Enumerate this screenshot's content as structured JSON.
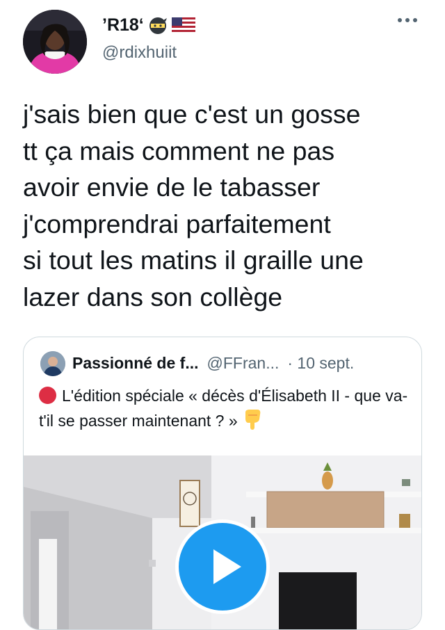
{
  "author": {
    "display_name": "’R18‘",
    "handle": "@rdixhuiit",
    "avatar_icon": "user-avatar",
    "badges": [
      "ninja-emoji-icon",
      "us-flag-icon"
    ]
  },
  "more_icon": "more-horizontal-icon",
  "tweet": {
    "text": "j'sais bien que c'est un gosse\ntt ça mais comment ne pas\navoir envie de le tabasser\nj'comprendrai parfaitement\nsi tout les matins il graille une\nlazer dans son collège"
  },
  "quote": {
    "display_name": "Passionné de f...",
    "handle": "@FFran...",
    "date": "· 10 sept.",
    "text": "L'édition spéciale « décès d'Élisabeth II - que va-t'il se passer maintenant ? »",
    "leading_icon": "red-circle-icon",
    "trailing_icon": "pointing-down-icon",
    "media_type": "video",
    "play_icon": "play-icon"
  },
  "colors": {
    "text": "#0f1419",
    "secondary": "#536471",
    "border": "#cfd9de",
    "accent": "#1d9bf0",
    "red_circle": "#dd2e44"
  }
}
